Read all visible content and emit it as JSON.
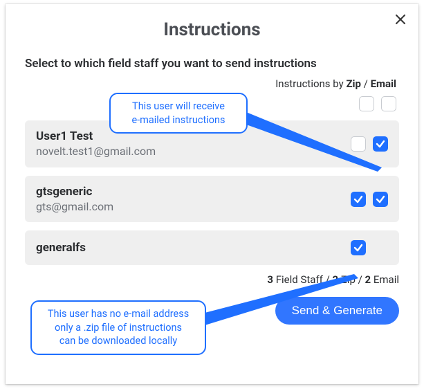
{
  "dialog": {
    "title": "Instructions",
    "subtitle": "Select to which field staff you want to send instructions",
    "columns_prefix": "Instructions by ",
    "col_zip": "Zip",
    "col_sep": " / ",
    "col_email": "Email"
  },
  "select_all": {
    "zip": false,
    "email": false
  },
  "users": [
    {
      "name": "User1 Test",
      "email": "novelt.test1@gmail.com",
      "zip": false,
      "email_checked": true,
      "has_email": true
    },
    {
      "name": "gtsgeneric",
      "email": "gts@gmail.com",
      "zip": true,
      "email_checked": true,
      "has_email": true
    },
    {
      "name": "generalfs",
      "email": "",
      "zip": true,
      "email_checked": false,
      "has_email": false
    }
  ],
  "summary": {
    "field_staff_count": "3",
    "field_staff_label": " Field Staff / ",
    "zip_count": "2",
    "zip_label": " Zip / ",
    "email_count": "2",
    "email_label": " Email"
  },
  "actions": {
    "send_generate": "Send & Generate"
  },
  "annotations": {
    "callout_top": "This user will receive\ne-mailed instructions",
    "callout_bottom": "This user has no e-mail address\nonly a .zip file of instructions\ncan be downloaded locally"
  }
}
